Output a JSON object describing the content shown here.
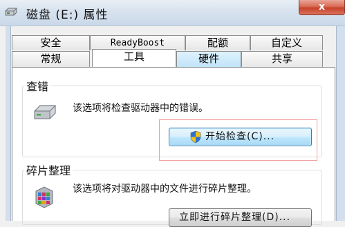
{
  "window": {
    "title": "磁盘 (E:) 属性",
    "close_label": "x"
  },
  "tabs": {
    "row1": [
      "安全",
      "ReadyBoost",
      "配额",
      "自定义"
    ],
    "row2": [
      "常规",
      "工具",
      "硬件",
      "共享"
    ],
    "active": "工具"
  },
  "error_check": {
    "group_label": "查错",
    "description": "该选项将检查驱动器中的错误。",
    "button_label": "开始检查(C)..."
  },
  "defrag": {
    "group_label": "碎片整理",
    "description": "该选项将对驱动器中的文件进行碎片整理。",
    "button_label": "立即进行碎片整理(D)..."
  },
  "icons": {
    "title": "drive-icon",
    "close": "close-icon",
    "error_check": "hard-drive-icon",
    "shield": "uac-shield-icon",
    "defrag": "defrag-icon"
  },
  "colors": {
    "titlebar": "#d7e2ee",
    "close_button": "#c8412a",
    "highlight_border": "#f2a0a0",
    "focused_button": "#bee6fd"
  }
}
